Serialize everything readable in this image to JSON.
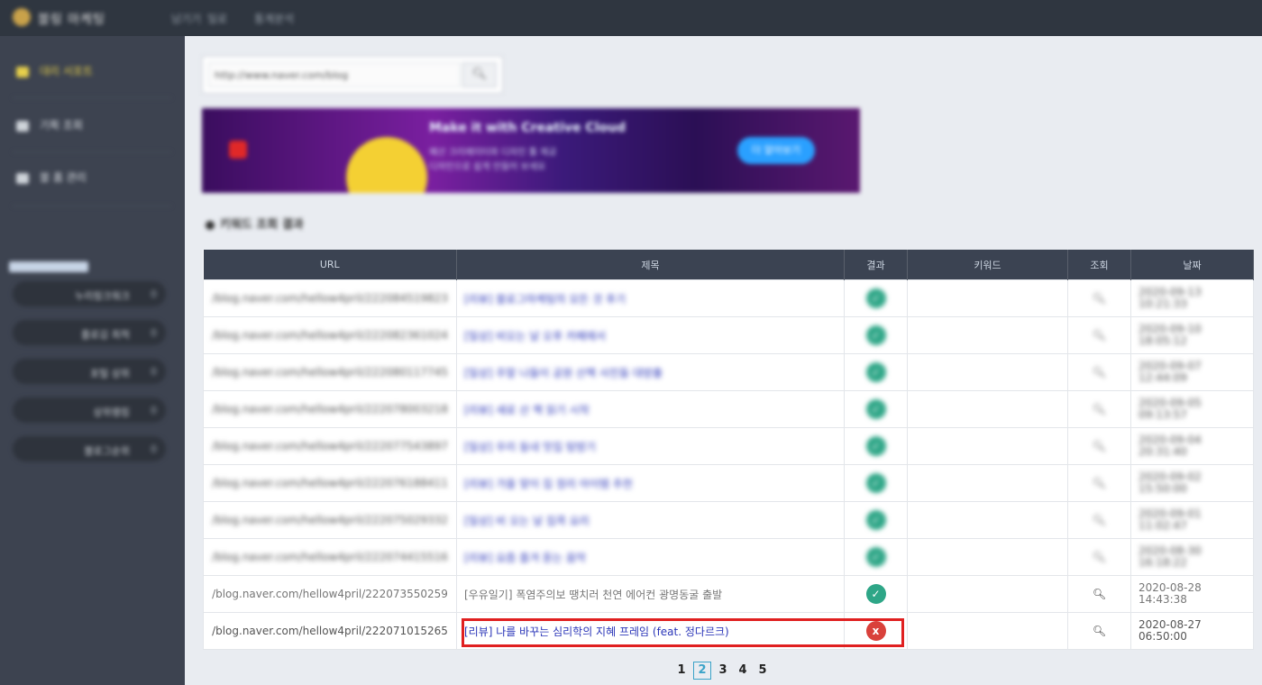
{
  "topbar": {
    "brand": "블링 마케팅",
    "nav": [
      "남기기",
      "일로",
      "통계분석"
    ]
  },
  "sidebar": {
    "items": [
      {
        "label": "대리 서포트",
        "active": true
      },
      {
        "label": "기획 조회",
        "active": false
      },
      {
        "label": "블 홈 관리",
        "active": false
      }
    ],
    "pills": [
      {
        "label": "누리링크워크",
        "count": "0"
      },
      {
        "label": "플로깅 최적",
        "count": "0"
      },
      {
        "label": "포털 상위",
        "count": "0"
      },
      {
        "label": "상위랭킹",
        "count": "0"
      },
      {
        "label": "블로그순위",
        "count": "0"
      }
    ]
  },
  "search": {
    "value": "http://www.naver.com/blog",
    "button_icon": "search-icon"
  },
  "ad": {
    "headline": "Make it with Creative Cloud",
    "sub1": "예산 크리에이터와 디자인 툴 제공",
    "sub2": "디자인으로 쉽게 만들어 보세요",
    "cta": "더 알아보기"
  },
  "section_title": "키워드 조회 결과",
  "table": {
    "headers": [
      "URL",
      "제목",
      "결과",
      "키워드",
      "조회",
      "날짜"
    ],
    "rows": [
      {
        "url": "/blog.naver.com/hellow4pril/222084519823",
        "title": "[리뷰] 블로그마케팅의 모든 것 후기",
        "result": "check",
        "date1": "2020-09-13",
        "date2": "10:21:33"
      },
      {
        "url": "/blog.naver.com/hellow4pril/222082361024",
        "title": "[일상] 비오는 날 오후 카페에서",
        "result": "check",
        "date1": "2020-09-10",
        "date2": "18:05:12"
      },
      {
        "url": "/blog.naver.com/hellow4pril/222080117745",
        "title": "[일상] 주말 나들이 공원 산책 사진들 대방출",
        "result": "check",
        "date1": "2020-09-07",
        "date2": "12:44:09"
      },
      {
        "url": "/blog.naver.com/hellow4pril/222078003218",
        "title": "[리뷰] 새로 산 책 읽기 시작",
        "result": "check",
        "date1": "2020-09-05",
        "date2": "09:13:57"
      },
      {
        "url": "/blog.naver.com/hellow4pril/222077543897",
        "title": "[일상] 우리 동네 맛집 탐방기",
        "result": "check",
        "date1": "2020-09-04",
        "date2": "20:31:40"
      },
      {
        "url": "/blog.naver.com/hellow4pril/222076188411",
        "title": "[리뷰] 가을 맞이 집 정리 아이템 추천",
        "result": "check",
        "date1": "2020-09-02",
        "date2": "15:50:00"
      },
      {
        "url": "/blog.naver.com/hellow4pril/222075029332",
        "title": "[일상] 비 오는 날 집콕 요리",
        "result": "check",
        "date1": "2020-09-01",
        "date2": "11:02:47"
      },
      {
        "url": "/blog.naver.com/hellow4pril/222074415516",
        "title": "[리뷰] 요즘 즐겨 듣는 음악",
        "result": "check",
        "date1": "2020-08-30",
        "date2": "16:18:22"
      },
      {
        "url": "/blog.naver.com/hellow4pril/222073550259",
        "title": "[우유일기] 폭염주의보 땡치러 천연 에어컨 광명동굴 출발",
        "result": "check",
        "date1": "2020-08-28",
        "date2": "14:43:38"
      },
      {
        "url": "/blog.naver.com/hellow4pril/222071015265",
        "title": "[리뷰] 나를 바꾸는 심리학의 지혜 프레임 (feat. 정다르크)",
        "result": "x",
        "date1": "2020-08-27",
        "date2": "06:50:00"
      }
    ]
  },
  "pagination": {
    "pages": [
      "1",
      "2",
      "3",
      "4",
      "5"
    ],
    "current": "2"
  }
}
